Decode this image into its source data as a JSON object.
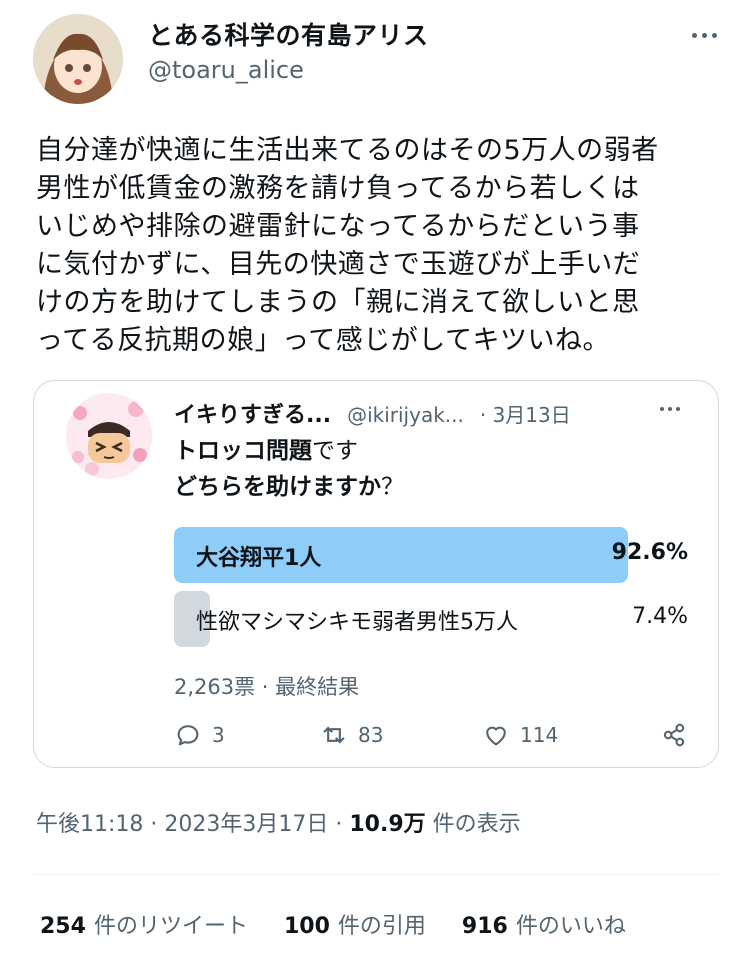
{
  "author": {
    "name": "とある科学の有島アリス",
    "handle": "@toaru_alice"
  },
  "tweet": {
    "text": "自分達が快適に生活出来てるのはその5万人の弱者\n男性が低賃金の激務を請け負ってるから若しくは\nいじめや排除の避雷針になってるからだという事\nに気付かずに、目先の快適さで玉遊びが上手いだ\nけの方を助けてしまうの「親に消えて欲しいと思\nってる反抗期の娘」って感じがしてキツいね。"
  },
  "quote": {
    "name": "イキりすぎる...",
    "handle": "@ikirijyak...",
    "date": "· 3月13日",
    "line1_bold": "トロッコ問題",
    "line1_rest": "です",
    "line2_bold": "どちらを助けますか",
    "line2_rest": "？",
    "poll": {
      "options": [
        {
          "label": "大谷翔平1人",
          "percent": "92.6%",
          "fraction": 0.926
        },
        {
          "label": "性欲マシマシキモ弱者男性5万人",
          "percent": "7.4%",
          "fraction": 0.074
        }
      ],
      "footer": "2,263票 · 最終結果"
    },
    "actions": {
      "reply_count": "3",
      "retweet_count": "83",
      "like_count": "114"
    }
  },
  "meta": {
    "time_date": "午後11:18 · 2023年3月17日 · ",
    "views": "10.9万",
    "views_label": " 件の表示"
  },
  "stats": {
    "retweets": "254",
    "retweets_label": "件のリツイート",
    "quotes": "100",
    "quotes_label": "件の引用",
    "likes": "916",
    "likes_label": "件のいいね"
  },
  "colors": {
    "accent_poll": "#8ecdf8",
    "poll_other": "#cfd9de",
    "secondary_text": "#536471"
  }
}
